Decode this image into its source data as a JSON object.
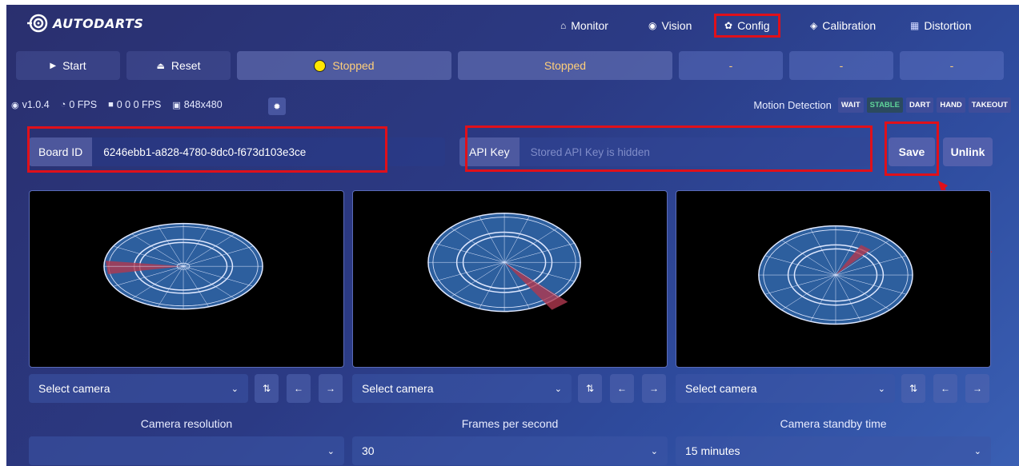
{
  "nav": {
    "brand": "AUTODARTS",
    "items": [
      {
        "label": "Monitor",
        "icon": "home-icon",
        "glyph": "⌂"
      },
      {
        "label": "Vision",
        "icon": "eye-icon",
        "glyph": "◉"
      },
      {
        "label": "Config",
        "icon": "gear-icon",
        "glyph": "✿"
      },
      {
        "label": "Calibration",
        "icon": "target-icon",
        "glyph": "◈"
      },
      {
        "label": "Distortion",
        "icon": "grid-icon",
        "glyph": "▦"
      }
    ]
  },
  "controls": {
    "start_label": "Start",
    "reset_label": "Reset",
    "status1": "Stopped",
    "status2": "Stopped",
    "slot1": "-",
    "slot2": "-",
    "slot3": "-"
  },
  "status": {
    "version": "v1.0.4",
    "fps": "0 FPS",
    "cam_fps": "0 0 0 FPS",
    "resolution": "848x480"
  },
  "motion": {
    "label": "Motion Detection",
    "states": [
      "WAIT",
      "STABLE",
      "DART",
      "HAND",
      "TAKEOUT"
    ],
    "active": "STABLE"
  },
  "board": {
    "board_id_label": "Board ID",
    "board_id_value": "6246ebb1-a828-4780-8dc0-f673d103e3ce",
    "api_key_label": "API Key",
    "api_key_placeholder": "Stored API Key is hidden",
    "save_label": "Save",
    "unlink_label": "Unlink"
  },
  "cameras": [
    {
      "select": "Select camera"
    },
    {
      "select": "Select camera"
    },
    {
      "select": "Select camera"
    }
  ],
  "settings": {
    "resolution_label": "Camera resolution",
    "resolution_value": "",
    "fps_label": "Frames per second",
    "fps_value": "30",
    "standby_label": "Camera standby time",
    "standby_value": "15 minutes"
  },
  "colors": {
    "highlight": "#e0101a",
    "stopped_text": "#ffcf7a",
    "stable_tag": "#5fd59a",
    "board_fill": "#2d5f9e",
    "segment_red": "#b0384f"
  }
}
